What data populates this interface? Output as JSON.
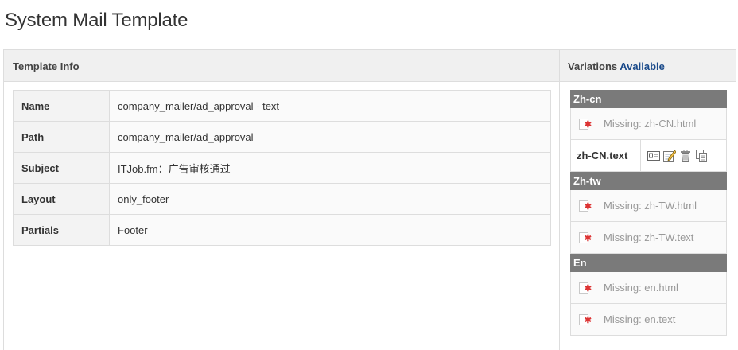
{
  "page_title": "System Mail Template",
  "template_info": {
    "heading": "Template Info",
    "rows": [
      {
        "key": "Name",
        "value": "company_mailer/ad_approval - text"
      },
      {
        "key": "Path",
        "value": "company_mailer/ad_approval"
      },
      {
        "key": "Subject",
        "value": "ITJob.fm：广告审核通过"
      },
      {
        "key": "Layout",
        "value": "only_footer"
      },
      {
        "key": "Partials",
        "value": "Footer"
      }
    ]
  },
  "variations": {
    "heading": "Variations",
    "heading_accent": "Available",
    "accent_color": "#1a4a8a",
    "groups": [
      {
        "name": "Zh-cn",
        "items": [
          {
            "label": "Missing: zh-CN.html",
            "status": "missing"
          },
          {
            "label": "zh-CN.text",
            "status": "present",
            "actions": [
              "preview-icon",
              "edit-icon",
              "delete-icon",
              "copy-icon"
            ]
          }
        ]
      },
      {
        "name": "Zh-tw",
        "items": [
          {
            "label": "Missing: zh-TW.html",
            "status": "missing"
          },
          {
            "label": "Missing: zh-TW.text",
            "status": "missing"
          }
        ]
      },
      {
        "name": "En",
        "items": [
          {
            "label": "Missing: en.html",
            "status": "missing"
          },
          {
            "label": "Missing: en.text",
            "status": "missing"
          }
        ]
      }
    ]
  }
}
